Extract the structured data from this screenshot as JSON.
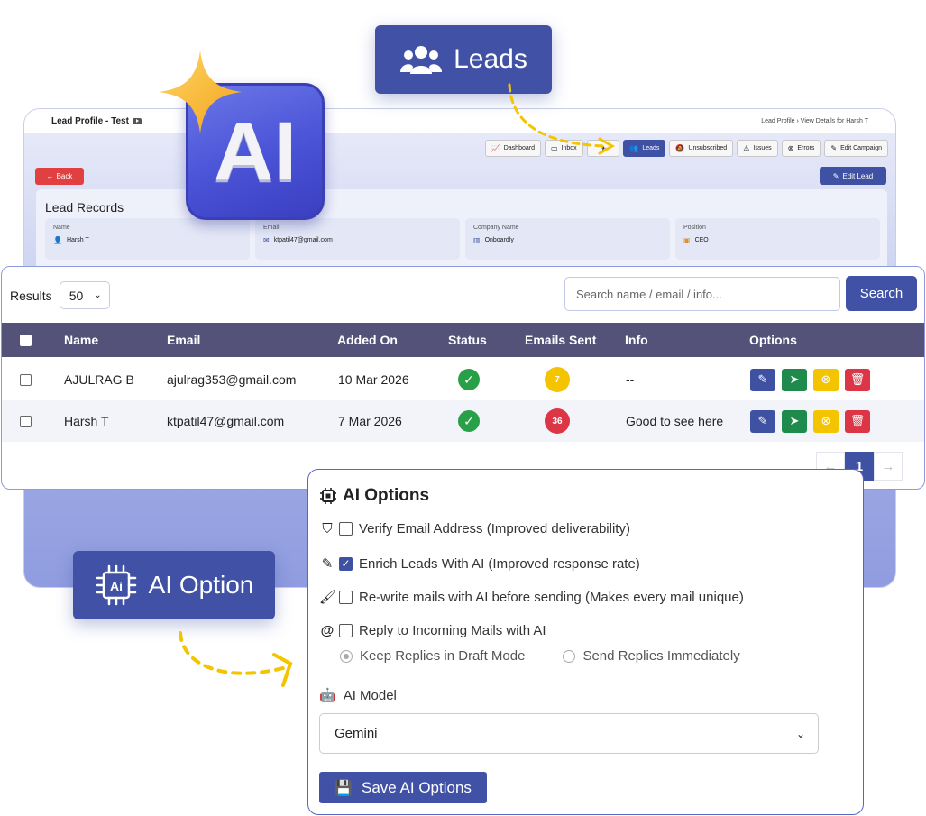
{
  "background_window": {
    "title": "Lead Profile - Test",
    "breadcrumb": "Lead Profile › View Details for Harsh T",
    "nav": [
      {
        "label": "Dashboard",
        "icon": "chart-icon"
      },
      {
        "label": "Inbox",
        "icon": "inbox-icon"
      },
      {
        "label": "",
        "icon": "plane-icon"
      },
      {
        "label": "Leads",
        "icon": "users-icon",
        "active": true
      },
      {
        "label": "Unsubscribed",
        "icon": "bell-slash-icon"
      },
      {
        "label": "Issues",
        "icon": "warning-icon"
      },
      {
        "label": "Errors",
        "icon": "error-icon"
      },
      {
        "label": "Edit Campaign",
        "icon": "edit-icon"
      }
    ],
    "back_label": "Back",
    "edit_lead_label": "Edit Lead",
    "card_title": "Lead Records",
    "fields": [
      {
        "label": "Name",
        "value": "Harsh T",
        "icon": "user-icon"
      },
      {
        "label": "Email",
        "value": "ktpatil47@gmail.com",
        "icon": "envelope-icon"
      },
      {
        "label": "Company Name",
        "value": "Onboardly",
        "icon": "building-icon"
      },
      {
        "label": "Position",
        "value": "CEO",
        "icon": "briefcase-icon"
      }
    ]
  },
  "badges": {
    "leads": "Leads",
    "ai_logo": "AI",
    "ai_option": "AI Option"
  },
  "table": {
    "results_label": "Results",
    "results_value": "50",
    "search_placeholder": "Search name / email / info...",
    "search_button": "Search",
    "columns": [
      "Name",
      "Email",
      "Added On",
      "Status",
      "Emails Sent",
      "Info",
      "Options"
    ],
    "rows": [
      {
        "name": "AJULRAG B",
        "email": "ajulrag353@gmail.com",
        "added": "10 Mar 2026",
        "sent": "7",
        "sent_color": "#f5c400",
        "info": "--"
      },
      {
        "name": "Harsh T",
        "email": "ktpatil47@gmail.com",
        "added": "7 Mar 2026",
        "sent": "36",
        "sent_color": "#dc3545",
        "info": "Good to see here"
      }
    ],
    "pagination": {
      "prev": "←",
      "current": "1",
      "next": "→"
    }
  },
  "ai_options": {
    "title": "AI Options",
    "options": [
      {
        "label": "Verify Email Address (Improved deliverability)",
        "checked": false,
        "icon": "shield-icon"
      },
      {
        "label": "Enrich Leads With AI (Improved response rate)",
        "checked": true,
        "icon": "pen-icon"
      },
      {
        "label": "Re-write mails with AI before sending (Makes every mail unique)",
        "checked": false,
        "icon": "brush-icon"
      },
      {
        "label": "Reply to Incoming Mails with AI",
        "checked": false,
        "icon": "at-icon"
      }
    ],
    "reply_modes": [
      {
        "label": "Keep Replies in Draft Mode",
        "selected": true
      },
      {
        "label": "Send Replies Immediately",
        "selected": false
      }
    ],
    "model_label": "AI Model",
    "model_value": "Gemini",
    "save_label": "Save AI Options"
  },
  "colors": {
    "primary": "#4152a6",
    "header": "#555279",
    "success": "#28a047",
    "danger": "#dc3545",
    "warning": "#f5c400"
  }
}
